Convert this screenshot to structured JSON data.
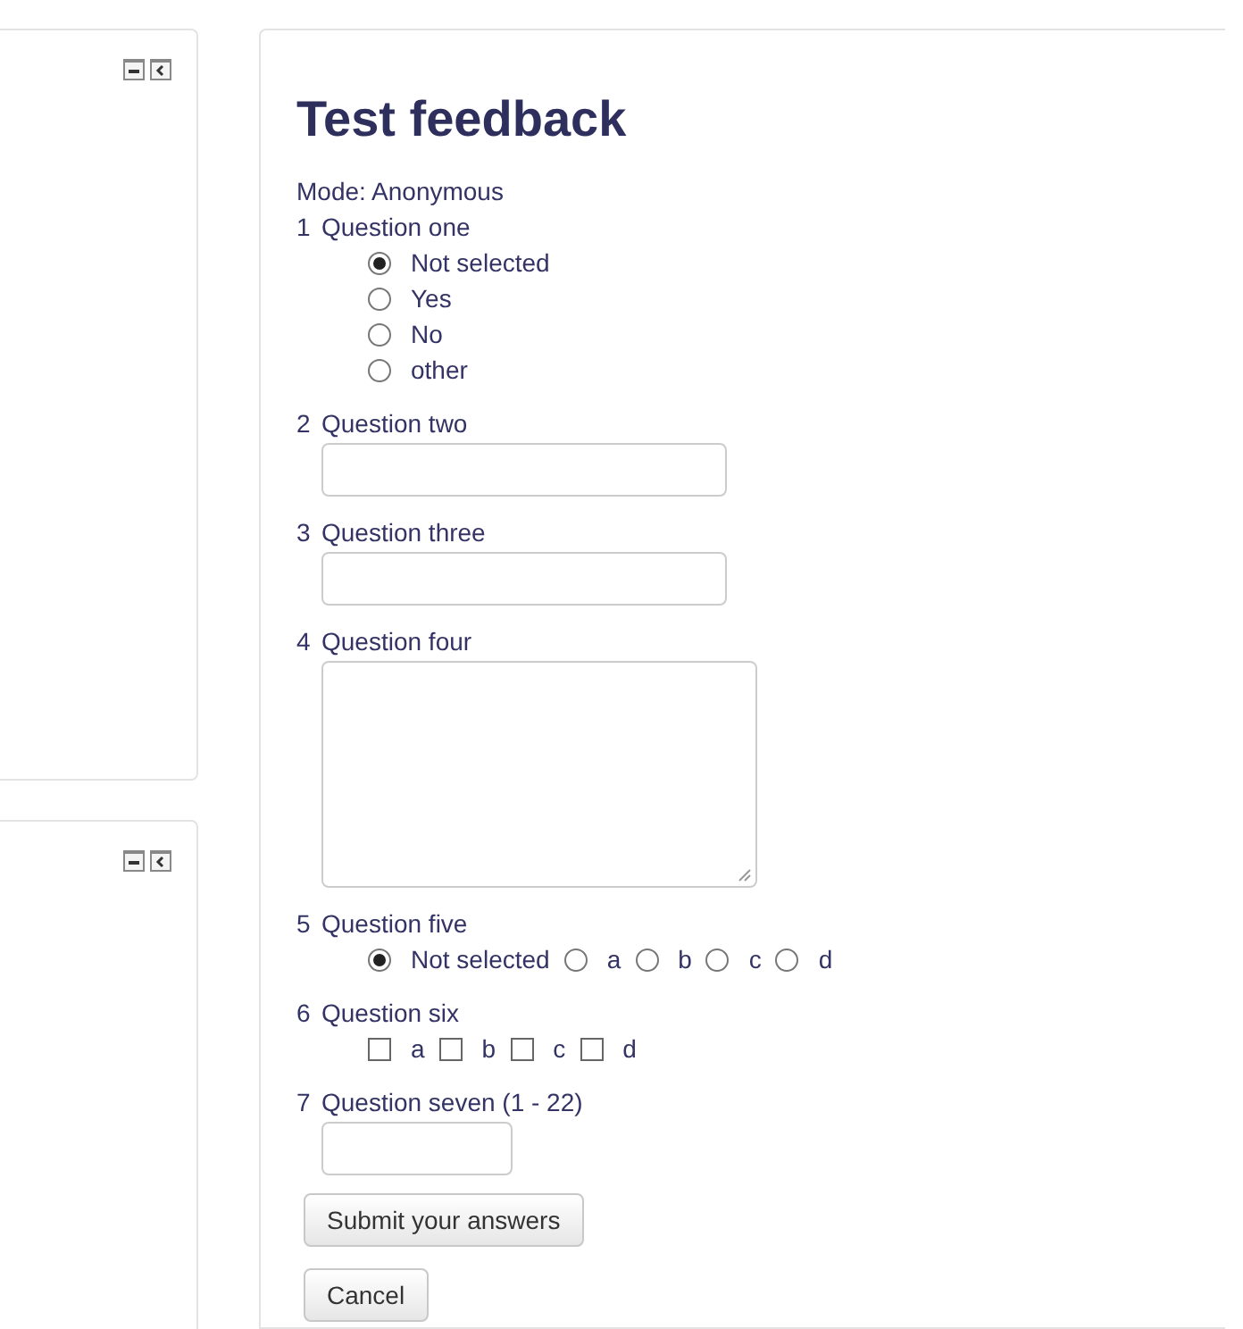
{
  "title": "Test feedback",
  "mode": "Mode: Anonymous",
  "questions": [
    {
      "number": "1",
      "label": "Question one",
      "kind": "radio-list",
      "options": [
        {
          "label": "Not selected",
          "selected": true
        },
        {
          "label": "Yes",
          "selected": false
        },
        {
          "label": "No",
          "selected": false
        },
        {
          "label": "other",
          "selected": false
        }
      ]
    },
    {
      "number": "2",
      "label": "Question two",
      "kind": "text"
    },
    {
      "number": "3",
      "label": "Question three",
      "kind": "text"
    },
    {
      "number": "4",
      "label": "Question four",
      "kind": "textarea"
    },
    {
      "number": "5",
      "label": "Question five",
      "kind": "radio-row",
      "options": [
        {
          "label": "Not selected",
          "selected": true
        },
        {
          "label": "a",
          "selected": false
        },
        {
          "label": "b",
          "selected": false
        },
        {
          "label": "c",
          "selected": false
        },
        {
          "label": "d",
          "selected": false
        }
      ]
    },
    {
      "number": "6",
      "label": "Question six",
      "kind": "checkbox-row",
      "options": [
        {
          "label": "a",
          "checked": false
        },
        {
          "label": "b",
          "checked": false
        },
        {
          "label": "c",
          "checked": false
        },
        {
          "label": "d",
          "checked": false
        }
      ]
    },
    {
      "number": "7",
      "label": "Question seven (1 - 22)",
      "kind": "short-text"
    }
  ],
  "buttons": [
    "Submit your answers",
    "Cancel"
  ]
}
